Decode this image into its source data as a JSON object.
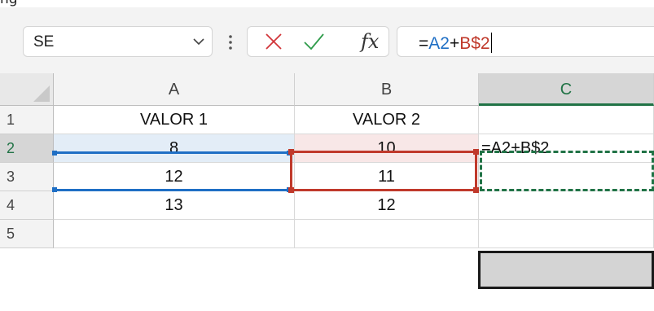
{
  "formula_bar": {
    "name_box_value": "SE",
    "formula_parts": [
      {
        "text": "=",
        "color": "#111111"
      },
      {
        "text": "A2",
        "color": "#1f6fc5"
      },
      {
        "text": "+",
        "color": "#111111"
      },
      {
        "text": "B$2",
        "color": "#c0392b"
      }
    ]
  },
  "icons": {
    "name_box_dropdown": "chevron-down-icon",
    "more_options": "vertical-dots-icon",
    "cancel": "x-icon",
    "enter": "checkmark-icon",
    "insert_function": "fx-icon"
  },
  "fx_label": "fx",
  "sheet": {
    "columns": [
      "A",
      "B",
      "C"
    ],
    "rows": [
      "1",
      "2",
      "3",
      "4",
      "5"
    ],
    "cells": {
      "A1": "VALOR 1",
      "B1": "VALOR 2",
      "C1": "",
      "A2": "8",
      "B2": "10",
      "C2": "=A2+B$2",
      "A3": "12",
      "B3": "11",
      "C3": "",
      "A4": "13",
      "B4": "12",
      "C4": "",
      "A5": "",
      "B5": "",
      "C5": ""
    },
    "active_cell": "C2",
    "highlighted_cell": "C4"
  },
  "colors": {
    "excel_green": "#217346",
    "ref_blue": "#1f6fc5",
    "ref_red": "#c0392b",
    "highlight_fill": "#d4d4d4"
  }
}
